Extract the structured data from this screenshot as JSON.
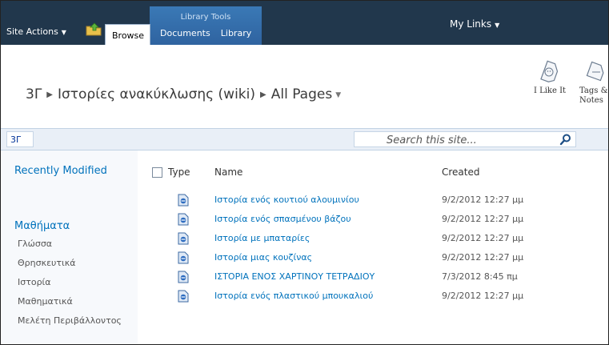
{
  "ribbon": {
    "context_group": "Library Tools",
    "site_actions": "Site Actions",
    "tabs": [
      {
        "label": "Browse"
      },
      {
        "label": "Documents"
      },
      {
        "label": "Library"
      }
    ],
    "my_links": "My Links"
  },
  "breadcrumb": {
    "site": "3Γ",
    "library": "Ιστορίες ανακύκλωσης (wiki)",
    "page": "All Pages"
  },
  "social": {
    "like_it": "I Like It",
    "tags_line1": "Tags &",
    "tags_line2": "Notes"
  },
  "search": {
    "site_chip": "3Γ",
    "placeholder": "Search this site..."
  },
  "quick_launch": {
    "recently_modified": "Recently Modified",
    "heading": "Μαθήματα",
    "items": [
      "Γλώσσα",
      "Θρησκευτικά",
      "Ιστορία",
      "Μαθηματικά",
      "Μελέτη Περιβάλλοντος"
    ]
  },
  "list": {
    "columns": {
      "type": "Type",
      "name": "Name",
      "created": "Created"
    },
    "rows": [
      {
        "name": "Ιστορία ενός κουτιού αλουμινίου",
        "created": "9/2/2012 12:27 μμ"
      },
      {
        "name": "Ιστορία ενός σπασμένου βάζου",
        "created": "9/2/2012 12:27 μμ"
      },
      {
        "name": "Ιστορία με μπαταρίες",
        "created": "9/2/2012 12:27 μμ"
      },
      {
        "name": "Ιστορία μιας κουζίνας",
        "created": "9/2/2012 12:27 μμ"
      },
      {
        "name": "ΙΣΤΟΡΙΑ ΕΝΟΣ ΧΑΡΤΙΝΟΥ ΤΕΤΡΑΔΙΟΥ",
        "created": "7/3/2012 8:45 πμ"
      },
      {
        "name": "Ιστορία ενός πλαστικού μπουκαλιού",
        "created": "9/2/2012 12:27 μμ"
      }
    ]
  },
  "colors": {
    "ribbon_bg": "#21374c",
    "context_tab_bg": "#3a79b6",
    "link_blue": "#0072bc"
  },
  "icons": [
    "navigate-up-icon",
    "i-like-it-icon",
    "tags-notes-icon",
    "search-icon",
    "wiki-page-icon"
  ]
}
